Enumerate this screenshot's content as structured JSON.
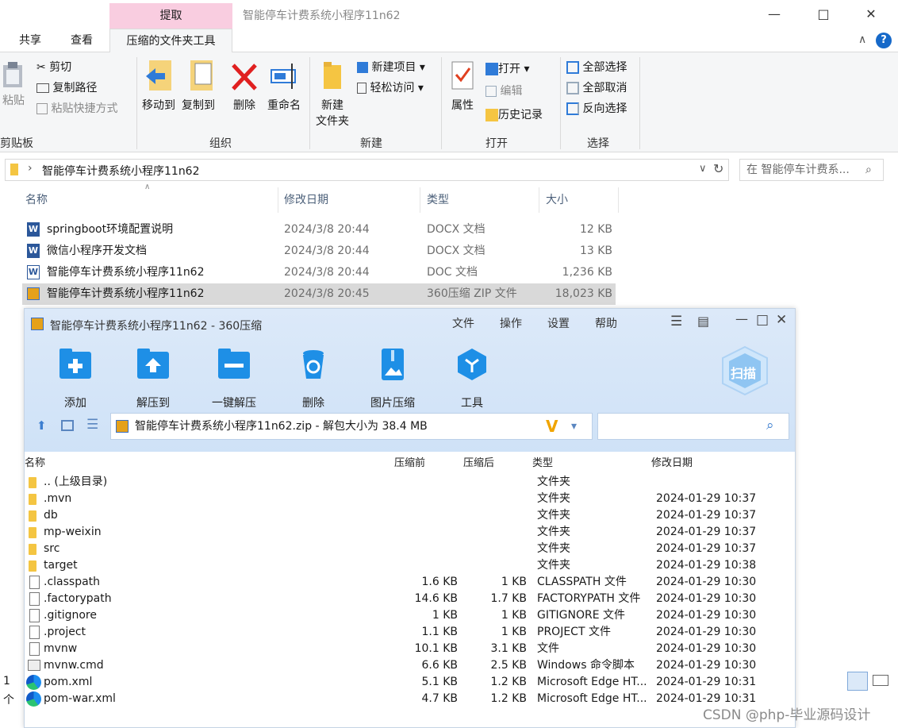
{
  "explorer": {
    "context_tab": "提取",
    "window_title": "智能停车计费系统小程序11n62",
    "ribbon_tabs": [
      "共享",
      "查看",
      "压缩的文件夹工具"
    ],
    "clipboard": {
      "paste": "粘贴",
      "cut": "剪切",
      "copy_path": "复制路径",
      "paste_shortcut": "粘贴快捷方式",
      "group": "剪贴板"
    },
    "organize": {
      "move_to": "移动到",
      "copy_to": "复制到",
      "delete": "删除",
      "rename": "重命名",
      "group": "组织"
    },
    "new": {
      "new_folder_1": "新建",
      "new_folder_2": "文件夹",
      "new_item": "新建项目",
      "easy_access": "轻松访问",
      "group": "新建"
    },
    "open": {
      "properties": "属性",
      "open": "打开",
      "edit": "编辑",
      "history": "历史记录",
      "group": "打开"
    },
    "select": {
      "select_all": "全部选择",
      "select_none": "全部取消",
      "invert": "反向选择",
      "group": "选择"
    },
    "address": {
      "path": "智能停车计费系统小程序11n62",
      "search_placeholder": "在 智能停车计费系..."
    },
    "columns": {
      "name": "名称",
      "modified": "修改日期",
      "type": "类型",
      "size": "大小"
    },
    "files": [
      {
        "name": "springboot环境配置说明",
        "modified": "2024/3/8 20:44",
        "type": "DOCX 文档",
        "size": "12 KB",
        "icon": "word-icon"
      },
      {
        "name": "微信小程序开发文档",
        "modified": "2024/3/8 20:44",
        "type": "DOCX 文档",
        "size": "13 KB",
        "icon": "word-icon"
      },
      {
        "name": "智能停车计费系统小程序11n62",
        "modified": "2024/3/8 20:44",
        "type": "DOC 文档",
        "size": "1,236 KB",
        "icon": "word-outline-icon"
      },
      {
        "name": "智能停车计费系统小程序11n62",
        "modified": "2024/3/8 20:45",
        "type": "360压缩 ZIP 文件",
        "size": "18,023 KB",
        "icon": "zip-icon",
        "selected": true
      }
    ],
    "status_left": "1 个"
  },
  "zip": {
    "title": "智能停车计费系统小程序11n62 - 360压缩",
    "menu": [
      "文件",
      "操作",
      "设置",
      "帮助"
    ],
    "tools": [
      "添加",
      "解压到",
      "一键解压",
      "删除",
      "图片压缩",
      "工具"
    ],
    "scan_label": "扫描",
    "path": "智能停车计费系统小程序11n62.zip - 解包大小为 38.4 MB",
    "columns": {
      "name": "名称",
      "before": "压缩前",
      "after": "压缩后",
      "type": "类型",
      "modified": "修改日期"
    },
    "rows": [
      {
        "name": ".. (上级目录)",
        "before": "",
        "after": "",
        "type": "文件夹",
        "modified": "",
        "kind": "folder"
      },
      {
        "name": ".mvn",
        "before": "",
        "after": "",
        "type": "文件夹",
        "modified": "2024-01-29 10:37",
        "kind": "folder"
      },
      {
        "name": "db",
        "before": "",
        "after": "",
        "type": "文件夹",
        "modified": "2024-01-29 10:37",
        "kind": "folder"
      },
      {
        "name": "mp-weixin",
        "before": "",
        "after": "",
        "type": "文件夹",
        "modified": "2024-01-29 10:37",
        "kind": "folder"
      },
      {
        "name": "src",
        "before": "",
        "after": "",
        "type": "文件夹",
        "modified": "2024-01-29 10:37",
        "kind": "folder"
      },
      {
        "name": "target",
        "before": "",
        "after": "",
        "type": "文件夹",
        "modified": "2024-01-29 10:38",
        "kind": "folder"
      },
      {
        "name": ".classpath",
        "before": "1.6 KB",
        "after": "1 KB",
        "type": "CLASSPATH 文件",
        "modified": "2024-01-29 10:30",
        "kind": "file"
      },
      {
        "name": ".factorypath",
        "before": "14.6 KB",
        "after": "1.7 KB",
        "type": "FACTORYPATH 文件",
        "modified": "2024-01-29 10:30",
        "kind": "file"
      },
      {
        "name": ".gitignore",
        "before": "1 KB",
        "after": "1 KB",
        "type": "GITIGNORE 文件",
        "modified": "2024-01-29 10:30",
        "kind": "file"
      },
      {
        "name": ".project",
        "before": "1.1 KB",
        "after": "1 KB",
        "type": "PROJECT 文件",
        "modified": "2024-01-29 10:30",
        "kind": "file"
      },
      {
        "name": "mvnw",
        "before": "10.1 KB",
        "after": "3.1 KB",
        "type": "文件",
        "modified": "2024-01-29 10:30",
        "kind": "file"
      },
      {
        "name": "mvnw.cmd",
        "before": "6.6 KB",
        "after": "2.5 KB",
        "type": "Windows 命令脚本",
        "modified": "2024-01-29 10:30",
        "kind": "cmd"
      },
      {
        "name": "pom.xml",
        "before": "5.1 KB",
        "after": "1.2 KB",
        "type": "Microsoft Edge HT...",
        "modified": "2024-01-29 10:31",
        "kind": "edge"
      },
      {
        "name": "pom-war.xml",
        "before": "4.7 KB",
        "after": "1.2 KB",
        "type": "Microsoft Edge HT...",
        "modified": "2024-01-29 10:31",
        "kind": "edge"
      }
    ]
  },
  "watermark": "CSDN @php-毕业源码设计"
}
